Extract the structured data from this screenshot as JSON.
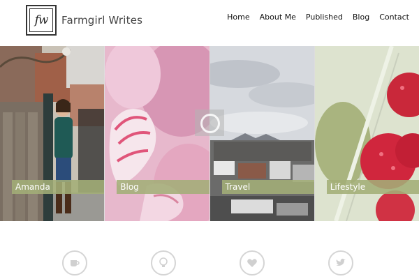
{
  "header": {
    "logo_monogram": "fw",
    "site_title": "Farmgirl Writes"
  },
  "nav": {
    "items": [
      "Home",
      "About Me",
      "Published",
      "Blog",
      "Contact"
    ]
  },
  "tiles": [
    {
      "label": "Amanda"
    },
    {
      "label": "Blog"
    },
    {
      "label": "Travel"
    },
    {
      "label": "Lifestyle"
    }
  ],
  "icons": [
    "coffee-cup-icon",
    "lightbulb-icon",
    "heart-icon",
    "twitter-bird-icon"
  ],
  "colors": {
    "label_bar": "#a3ae78",
    "icon_ring": "#d5d5d5"
  }
}
